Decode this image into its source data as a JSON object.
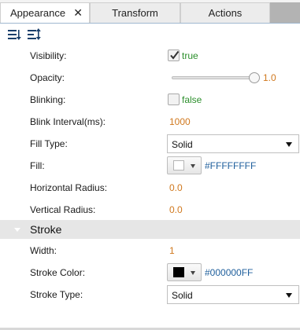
{
  "tabs": [
    {
      "label": "Appearance",
      "active": true,
      "close_glyph": "✕"
    },
    {
      "label": "Transform",
      "active": false
    },
    {
      "label": "Actions",
      "active": false
    }
  ],
  "toolbar": {
    "icons": [
      "sort-descending-icon",
      "sort-by-category-icon"
    ]
  },
  "properties": {
    "visibility": {
      "label": "Visibility:",
      "checked": true,
      "value": "true"
    },
    "opacity": {
      "label": "Opacity:",
      "value": "1.0",
      "level": 1.0
    },
    "blinking": {
      "label": "Blinking:",
      "checked": false,
      "value": "false"
    },
    "blink_interval": {
      "label": "Blink Interval(ms):",
      "value": "1000"
    },
    "fill_type": {
      "label": "Fill Type:",
      "value": "Solid"
    },
    "fill": {
      "label": "Fill:",
      "value": "#FFFFFFFF",
      "swatch": "#FFFFFF"
    },
    "horizontal_radius": {
      "label": "Horizontal Radius:",
      "value": "0.0"
    },
    "vertical_radius": {
      "label": "Vertical Radius:",
      "value": "0.0"
    }
  },
  "stroke_section": {
    "title": "Stroke",
    "width": {
      "label": "Width:",
      "value": "1"
    },
    "stroke_color": {
      "label": "Stroke Color:",
      "value": "#000000FF",
      "swatch": "#000000"
    },
    "stroke_type": {
      "label": "Stroke Type:",
      "value": "Solid"
    }
  },
  "colors": {
    "number": "#d0781e",
    "boolean": "#2c8f2c",
    "color_value": "#1f5f9c",
    "toolbar_border": "#9fb8d0"
  }
}
